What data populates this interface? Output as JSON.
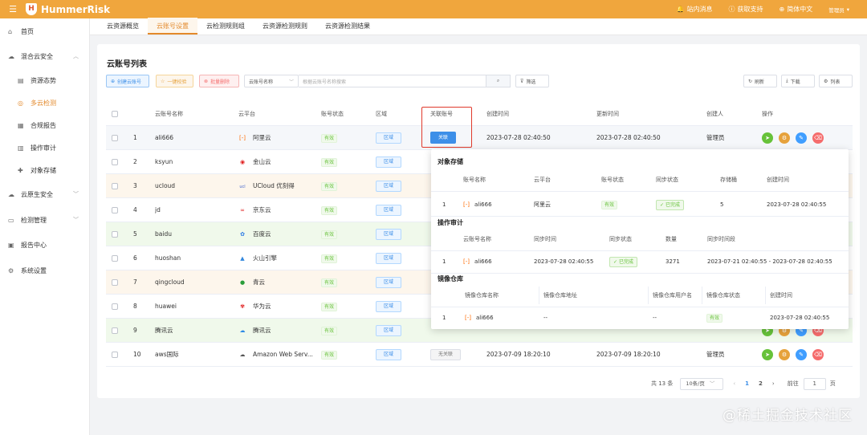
{
  "app": {
    "name": "HummerRisk",
    "logo_letter": "H",
    "brand_color": "#f0a63d",
    "accent": "#e3892b"
  },
  "topbar": {
    "messages": "站内消息",
    "support": "获取支持",
    "language": "简体中文",
    "user": "管理员"
  },
  "sidebar": {
    "items": [
      {
        "label": "首页",
        "icon": "home-icon"
      },
      {
        "label": "混合云安全",
        "icon": "cloud-icon"
      },
      {
        "label": "资源态势",
        "icon": "chart-icon"
      },
      {
        "label": "多云检测",
        "icon": "detect-icon"
      },
      {
        "label": "合规报告",
        "icon": "report-icon"
      },
      {
        "label": "操作审计",
        "icon": "audit-icon"
      },
      {
        "label": "对象存储",
        "icon": "storage-icon"
      },
      {
        "label": "云原生安全",
        "icon": "cloud-native-icon"
      },
      {
        "label": "检测管理",
        "icon": "manage-icon"
      },
      {
        "label": "报告中心",
        "icon": "report-center-icon"
      },
      {
        "label": "系统设置",
        "icon": "settings-icon"
      }
    ]
  },
  "tabs": [
    "云资源概览",
    "云账号设置",
    "云检测规则组",
    "云资源检测规则",
    "云资源检测结果"
  ],
  "card": {
    "title": "云账号列表"
  },
  "toolbar": {
    "create": "创建云账号",
    "verify": "一键校验",
    "batch_delete": "批量删除",
    "search_field": "云账号名称",
    "search_placeholder": "根据云账号名称搜索",
    "filter": "筛选",
    "refresh": "刷新",
    "download": "下载",
    "columns": "列表"
  },
  "table": {
    "headers": {
      "name": "云账号名称",
      "platform": "云平台",
      "status": "账号状态",
      "region": "区域",
      "linked": "关联账号",
      "created": "创建时间",
      "updated": "更新时间",
      "creator": "创建人",
      "ops": "操作"
    },
    "status_ok": "有效",
    "region_label": "区域",
    "link_label": "关联",
    "unlinked_label": "无关联",
    "rows": [
      {
        "idx": "1",
        "name": "ali666",
        "platform": "阿里云",
        "created": "2023-07-28 02:40:50",
        "updated": "2023-07-28 02:40:50",
        "creator": "管理员"
      },
      {
        "idx": "2",
        "name": "ksyun",
        "platform": "金山云"
      },
      {
        "idx": "3",
        "name": "ucloud",
        "platform": "UCloud 优刻得"
      },
      {
        "idx": "4",
        "name": "jd",
        "platform": "京东云"
      },
      {
        "idx": "5",
        "name": "baidu",
        "platform": "百度云"
      },
      {
        "idx": "6",
        "name": "huoshan",
        "platform": "火山引擎"
      },
      {
        "idx": "7",
        "name": "qingcloud",
        "platform": "青云"
      },
      {
        "idx": "8",
        "name": "huawei",
        "platform": "华为云"
      },
      {
        "idx": "9",
        "name": "腾讯云",
        "platform": "腾讯云"
      },
      {
        "idx": "10",
        "name": "aws国际",
        "platform": "Amazon Web Serv...",
        "created": "2023-07-09 18:20:10",
        "updated": "2023-07-09 18:20:10",
        "creator": "管理员"
      }
    ]
  },
  "popup": {
    "storage": {
      "title": "对象存储",
      "headers": {
        "name": "账号名称",
        "platform": "云平台",
        "status": "账号状态",
        "sync": "同步状态",
        "bucket": "存储桶",
        "created": "创建时间"
      },
      "row": {
        "idx": "1",
        "name": "ali666",
        "platform": "阿里云",
        "status": "有效",
        "sync": "已完成",
        "bucket": "5",
        "created": "2023-07-28 02:40:55"
      }
    },
    "audit": {
      "title": "操作审计",
      "headers": {
        "name": "云账号名称",
        "sync_time": "同步时间",
        "sync": "同步状态",
        "count": "数量",
        "range": "同步时间段"
      },
      "row": {
        "idx": "1",
        "name": "ali666",
        "sync_time": "2023-07-28 02:40:55",
        "sync": "已完成",
        "count": "3271",
        "range": "2023-07-21 02:40:55 - 2023-07-28 02:40:55"
      }
    },
    "registry": {
      "title": "镜像仓库",
      "headers": {
        "name": "镜像仓库名称",
        "address": "镜像仓库地址",
        "user": "镜像仓库用户名",
        "status": "镜像仓库状态",
        "created": "创建时间"
      },
      "row": {
        "idx": "1",
        "name": "ali666",
        "address": "--",
        "user": "--",
        "status": "有效",
        "created": "2023-07-28 02:40:55"
      }
    }
  },
  "pager": {
    "total": "共 13 条",
    "size": "10条/页",
    "p1": "1",
    "p2": "2",
    "goto": "前往",
    "goto_val": "1",
    "page_unit": "页"
  },
  "watermark": "@稀土掘金技术社区"
}
